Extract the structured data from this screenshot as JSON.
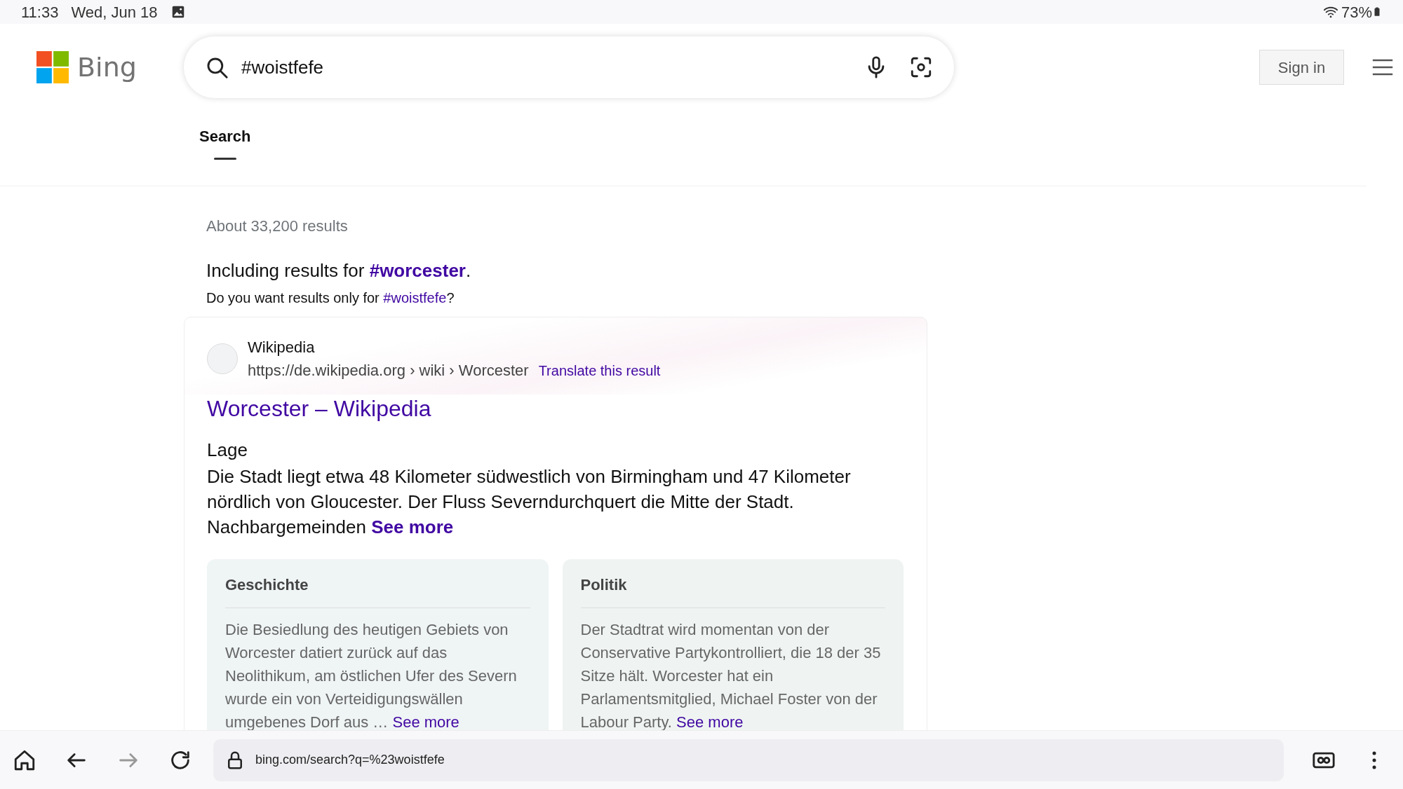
{
  "status_bar": {
    "time": "11:33",
    "date": "Wed, Jun 18",
    "battery": "73%"
  },
  "header": {
    "logo_text": "Bing",
    "search": {
      "value": "#woistfefe"
    },
    "sign_in": "Sign in"
  },
  "tabs": [
    {
      "label": "Search",
      "selected": true
    }
  ],
  "results_count": "About 33,200 results",
  "spelling": {
    "including_prefix": "Including results for ",
    "including_link": "#worcester",
    "including_suffix": ".",
    "question_prefix": "Do you want results only for ",
    "question_link": "#woistfefe",
    "question_suffix": "?"
  },
  "result": {
    "site": "Wikipedia",
    "url": "https://de.wikipedia.org › wiki › Worcester",
    "translate": "Translate this result",
    "title": "Worcester – Wikipedia",
    "section": "Lage",
    "snippet": "Die Stadt liegt etwa 48 Kilometer südwestlich von Birmingham und 47 Kilometer nördlich von Gloucester. Der Fluss Severndurchquert die Mitte der Stadt. Nachbargemeinden",
    "see_more": "See more",
    "cards": [
      {
        "heading": "Geschichte",
        "text": "Die Besiedlung des heutigen Gebiets von Worcester datiert zurück auf das Neolithikum, am östlichen Ufer des Severn wurde ein von Verteidigungswällen umgebenes Dorf aus …",
        "see_more": "See more"
      },
      {
        "heading": "Politik",
        "text": "Der Stadtrat wird momentan von der Conservative Partykontrolliert, die 18 der 35 Sitze hält. Worcester hat ein Parlamentsmitglied, Michael Foster von der Labour Party.",
        "see_more": "See more"
      }
    ]
  },
  "browser_bar": {
    "forward_disabled": true,
    "url": "bing.com/search?q=%23woistfefe"
  }
}
